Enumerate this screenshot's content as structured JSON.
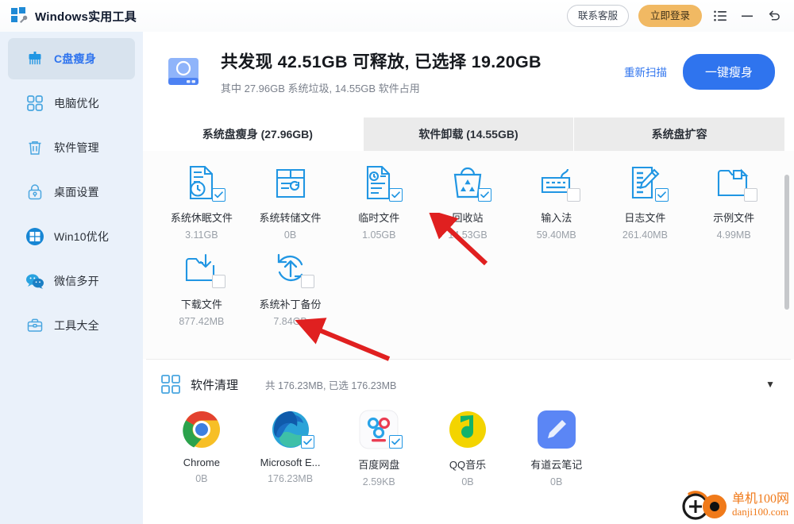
{
  "window": {
    "title": "Windows实用工具",
    "logo_icon": "windows-tools-icon",
    "support_label": "联系客服",
    "login_label": "立即登录",
    "menu_icon": "list-menu-icon",
    "minimize_icon": "minimize-icon",
    "close_icon": "undo-close-icon"
  },
  "sidebar": {
    "items": [
      {
        "label": "C盘瘦身",
        "icon": "broom-icon",
        "active": true
      },
      {
        "label": "电脑优化",
        "icon": "grid-four-icon",
        "active": false
      },
      {
        "label": "软件管理",
        "icon": "trash-icon",
        "active": false
      },
      {
        "label": "桌面设置",
        "icon": "lock-icon",
        "active": false
      },
      {
        "label": "Win10优化",
        "icon": "windows-icon",
        "active": false
      },
      {
        "label": "微信多开",
        "icon": "wechat-icon",
        "active": false
      },
      {
        "label": "工具大全",
        "icon": "toolbox-icon",
        "active": false
      }
    ]
  },
  "summary": {
    "disk_icon": "hard-disk-icon",
    "title": "共发现 42.51GB 可释放, 已选择 19.20GB",
    "subtitle": "其中 27.96GB 系统垃圾, 14.55GB 软件占用",
    "rescan_label": "重新扫描",
    "action_label": "一键瘦身"
  },
  "tabs": [
    {
      "label": "系统盘瘦身 (27.96GB)",
      "active": true
    },
    {
      "label": "软件卸载 (14.55GB)",
      "active": false
    },
    {
      "label": "系统盘扩容",
      "active": false
    }
  ],
  "system_items": [
    {
      "name": "系统休眠文件",
      "size": "3.11GB",
      "icon": "hibernate-file-icon",
      "checkbox": "checked"
    },
    {
      "name": "系统转储文件",
      "size": "0B",
      "icon": "dump-file-icon",
      "checkbox": "none"
    },
    {
      "name": "临时文件",
      "size": "1.05GB",
      "icon": "temp-file-icon",
      "checkbox": "checked"
    },
    {
      "name": "回收站",
      "size": "14.53GB",
      "icon": "recycle-bin-icon",
      "checkbox": "checked"
    },
    {
      "name": "输入法",
      "size": "59.40MB",
      "icon": "keyboard-icon",
      "checkbox": "unchecked"
    },
    {
      "name": "日志文件",
      "size": "261.40MB",
      "icon": "log-file-icon",
      "checkbox": "checked"
    },
    {
      "name": "示例文件",
      "size": "4.99MB",
      "icon": "sample-folder-icon",
      "checkbox": "unchecked"
    },
    {
      "name": "下载文件",
      "size": "877.42MB",
      "icon": "download-folder-icon",
      "checkbox": "unchecked"
    },
    {
      "name": "系统补丁备份",
      "size": "7.84GB",
      "icon": "patch-backup-icon",
      "checkbox": "unchecked"
    }
  ],
  "software_section": {
    "icon": "grid-four-icon",
    "title": "软件清理",
    "meta": "共 176.23MB, 已选 176.23MB",
    "caret_icon": "chevron-down-icon"
  },
  "software_items": [
    {
      "name": "Chrome",
      "size": "0B",
      "icon": "chrome-icon",
      "checkbox": "none"
    },
    {
      "name": "Microsoft E...",
      "size": "176.23MB",
      "icon": "edge-icon",
      "checkbox": "checked"
    },
    {
      "name": "百度网盘",
      "size": "2.59KB",
      "icon": "baidu-pan-icon",
      "checkbox": "checked"
    },
    {
      "name": "QQ音乐",
      "size": "0B",
      "icon": "qq-music-icon",
      "checkbox": "none"
    },
    {
      "name": "有道云笔记",
      "size": "0B",
      "icon": "youdao-note-icon",
      "checkbox": "none"
    }
  ],
  "annotations": [
    {
      "name": "arrow-to-recycle-bin",
      "color": "#e02020"
    },
    {
      "name": "arrow-to-patch-backup",
      "color": "#e02020"
    }
  ],
  "watermark": {
    "cn": "单机100网",
    "en": "danji100.com",
    "color": "#f07a1a"
  },
  "colors": {
    "accent_blue": "#2f74ee",
    "icon_blue": "#2196e3",
    "login_orange": "#f1b963",
    "sidebar_bg": "#eaf1fa",
    "sidebar_active": "#d8e3ee"
  }
}
